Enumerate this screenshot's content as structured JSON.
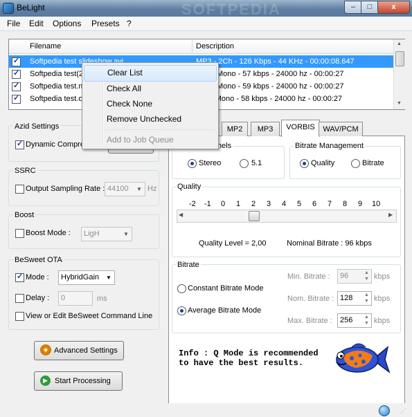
{
  "window": {
    "title": "BeLight",
    "watermark": "SOFTPEDIA",
    "min_label": "‒",
    "max_label": "□",
    "close_label": "x"
  },
  "menu": {
    "file": "File",
    "edit": "Edit",
    "options": "Options",
    "presets": "Presets",
    "help": "?"
  },
  "filelist": {
    "col_filename": "Filename",
    "col_description": "Description",
    "rows": [
      {
        "checked": true,
        "selected": true,
        "filename": "Softpedia test slideshow.avi",
        "description": "MP3 - 2Ch - 126 Kbps - 44 KHz - 00:00:08.647"
      },
      {
        "checked": true,
        "selected": false,
        "filename": "Softpedia test(2",
        "description": "Mono - 57 kbps - 24000 hz - 00:00:27"
      },
      {
        "checked": true,
        "selected": false,
        "filename": "Softpedia test.m",
        "description": "Mono - 59 kbps - 24000 hz - 00:00:27"
      },
      {
        "checked": true,
        "selected": false,
        "filename": "Softpedia test.o",
        "description": "- Mono - 58 kbps - 24000 hz - 00:00:27"
      }
    ]
  },
  "context_menu": {
    "clear_list": "Clear List",
    "check_all": "Check All",
    "check_none": "Check None",
    "remove_unchecked": "Remove Unchecked",
    "add_to_job_queue": "Add to Job Queue"
  },
  "azid": {
    "title": "Azid Settings",
    "dynamic_compression": "Dynamic Compre",
    "dynamic_checked": true
  },
  "ssrc": {
    "title": "SSRC",
    "output_sampling_rate": "Output Sampling Rate :",
    "rate_value": "44100",
    "unit": "Hz",
    "checked": false
  },
  "boost": {
    "title": "Boost",
    "boost_mode": "Boost Mode :",
    "mode_value": "LigH",
    "checked": false
  },
  "besweet": {
    "title": "BeSweet OTA",
    "mode_label": "Mode :",
    "mode_checked": true,
    "mode_value": "HybridGain",
    "delay_label": "Delay :",
    "delay_checked": false,
    "delay_value": "0",
    "delay_unit": "ms",
    "view_edit": "View or Edit BeSweet Command Line",
    "view_edit_checked": false
  },
  "buttons": {
    "advanced_settings": "Advanced Settings",
    "start_processing": "Start Processing"
  },
  "tabs": {
    "mp2": "MP2",
    "mp3": "MP3",
    "vorbis": "VORBIS",
    "wav": "WAV/PCM",
    "active": "VORBIS"
  },
  "channels": {
    "title": "nels",
    "stereo": "Stereo",
    "five_one": "5.1",
    "selected": "Stereo"
  },
  "bitrate_mgmt": {
    "title": "Bitrate Management",
    "quality": "Quality",
    "bitrate": "Bitrate",
    "selected": "Quality"
  },
  "quality": {
    "title": "Quality",
    "ticks": [
      "-2",
      "-1",
      "0",
      "1",
      "2",
      "3",
      "4",
      "5",
      "6",
      "7",
      "8",
      "9",
      "10"
    ],
    "level_text": "Quality Level = 2,00",
    "nominal_text": "Nominal Bitrate : 96 kbps",
    "slider_value": 2
  },
  "bitrate": {
    "title": "Bitrate",
    "constant": "Constant Bitrate Mode",
    "average": "Average Bitrate Mode",
    "selected": "Average Bitrate Mode",
    "min_label": "Min. Bitrate :",
    "min_value": "96",
    "nom_label": "Nom. Bitrate :",
    "nom_value": "128",
    "max_label": "Max. Bitrate :",
    "max_value": "256",
    "unit": "kbps"
  },
  "info": {
    "line1": "Info : Q Mode is recommended",
    "line2": "to have the best results."
  },
  "icons": [
    "app-icon",
    "gear-icon",
    "play-icon",
    "fish-icon",
    "globe-icon",
    "chevron-down-icon"
  ]
}
